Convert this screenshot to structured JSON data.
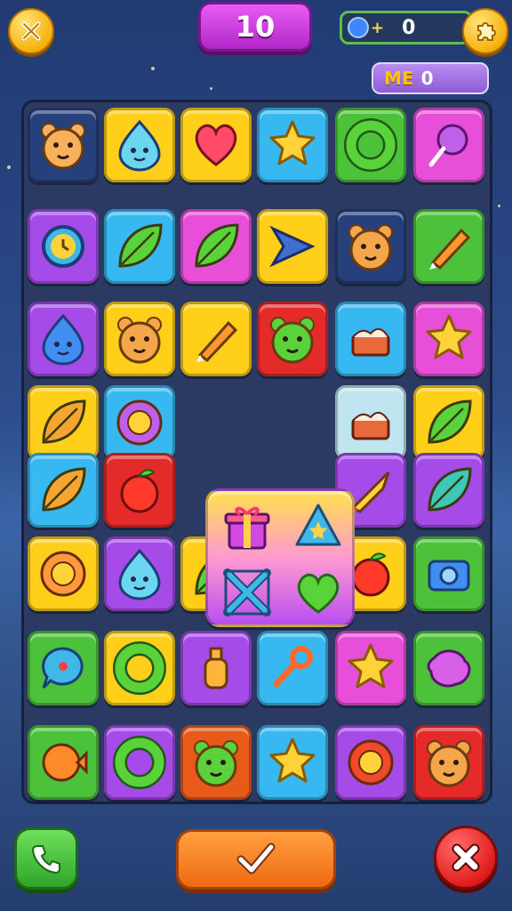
{
  "header": {
    "score": "10",
    "counter_value": "0",
    "counter_icon": "gem-plus-icon",
    "me_label": "ME",
    "me_value": "0",
    "left_button_icon": "close-icon",
    "right_button_icon": "puzzle-icon"
  },
  "colors": {
    "score_pill": "#c23cd8",
    "board": "#2b3a63",
    "ok_button": "#f07a20",
    "call_button": "#3cbf35",
    "close_button": "#e21d1d"
  },
  "board": {
    "rows": [
      [
        {
          "bg": "#25407a",
          "icon": "tiger-face-icon"
        },
        {
          "bg": "#ffcf1a",
          "icon": "blue-blob-icon"
        },
        {
          "bg": "#ffcf1a",
          "icon": "heart-creature-icon"
        },
        {
          "bg": "#37b8f0",
          "icon": "gold-star-icon"
        },
        {
          "bg": "#4cc23a",
          "icon": "green-ring-icon"
        },
        {
          "bg": "#e84fd8",
          "icon": "purple-lollipop-icon"
        }
      ],
      [
        {
          "bg": "#a44be8",
          "icon": "clock-icon"
        },
        {
          "bg": "#37b8f0",
          "icon": "leaf-brush-icon"
        },
        {
          "bg": "#e84fd8",
          "icon": "green-kite-icon"
        },
        {
          "bg": "#ffcf1a",
          "icon": "blue-arrow-icon"
        },
        {
          "bg": "#25407a",
          "icon": "bear-face-icon"
        },
        {
          "bg": "#4cc23a",
          "icon": "pencil-icon"
        }
      ],
      [
        {
          "bg": "#a44be8",
          "icon": "water-drop-icon"
        },
        {
          "bg": "#ffcf1a",
          "icon": "orange-bear-icon"
        },
        {
          "bg": "#ffcf1a",
          "icon": "paint-brush-icon"
        },
        {
          "bg": "#e52a2a",
          "icon": "green-monster-icon"
        },
        {
          "bg": "#37b8f0",
          "icon": "cupcake-icon"
        },
        {
          "bg": "#e84fd8",
          "icon": "gold-star-icon"
        }
      ],
      [
        {
          "bg": "#ffcf1a",
          "icon": "pear-icon"
        },
        {
          "bg": "#37b8f0",
          "icon": "purple-flower-icon"
        },
        {
          "special": true
        },
        {
          "special": true
        },
        {
          "bg": "#bfe6f0",
          "icon": "cake-icon"
        },
        {
          "bg": "#ffcf1a",
          "icon": "green-leaf-icon"
        }
      ],
      [
        {
          "bg": "#37b8f0",
          "icon": "feather-icon"
        },
        {
          "bg": "#e52a2a",
          "icon": "apple-icon"
        },
        {
          "special": true
        },
        {
          "special": true
        },
        {
          "bg": "#a44be8",
          "icon": "rocket-icon"
        },
        {
          "bg": "#a44be8",
          "icon": "teal-leaf-icon"
        }
      ],
      [
        {
          "bg": "#ffcf1a",
          "icon": "sun-flower-icon"
        },
        {
          "bg": "#a44be8",
          "icon": "blue-ghost-icon"
        },
        {
          "bg": "#ffcf1a",
          "icon": "leaf-icon"
        },
        {
          "bg": "#e52a2a",
          "icon": "picture-frame-icon"
        },
        {
          "bg": "#ffcf1a",
          "icon": "red-pepper-icon"
        },
        {
          "bg": "#4cc23a",
          "icon": "camera-icon"
        }
      ],
      [
        {
          "bg": "#4cc23a",
          "icon": "chat-bubble-icon"
        },
        {
          "bg": "#ffcf1a",
          "icon": "green-ring-icon"
        },
        {
          "bg": "#a44be8",
          "icon": "bottle-icon"
        },
        {
          "bg": "#37b8f0",
          "icon": "key-icon"
        },
        {
          "bg": "#e84fd8",
          "icon": "gold-star-icon"
        },
        {
          "bg": "#4cc23a",
          "icon": "purple-splat-icon"
        }
      ],
      [
        {
          "bg": "#4cc23a",
          "icon": "orange-fish-icon"
        },
        {
          "bg": "#a44be8",
          "icon": "orange-ring-icon"
        },
        {
          "bg": "#e85a1a",
          "icon": "green-cat-icon"
        },
        {
          "bg": "#37b8f0",
          "icon": "gold-star-icon"
        },
        {
          "bg": "#a44be8",
          "icon": "red-sun-icon"
        },
        {
          "bg": "#e52a2a",
          "icon": "bear-face-icon"
        }
      ]
    ],
    "special_tile": {
      "icons": [
        "gift-icon",
        "triangle-star-icon",
        "blue-bow-icon",
        "green-heart-icon"
      ]
    }
  },
  "footer": {
    "call_icon": "phone-icon",
    "confirm_icon": "checkmark-icon",
    "close_icon": "close-icon"
  }
}
